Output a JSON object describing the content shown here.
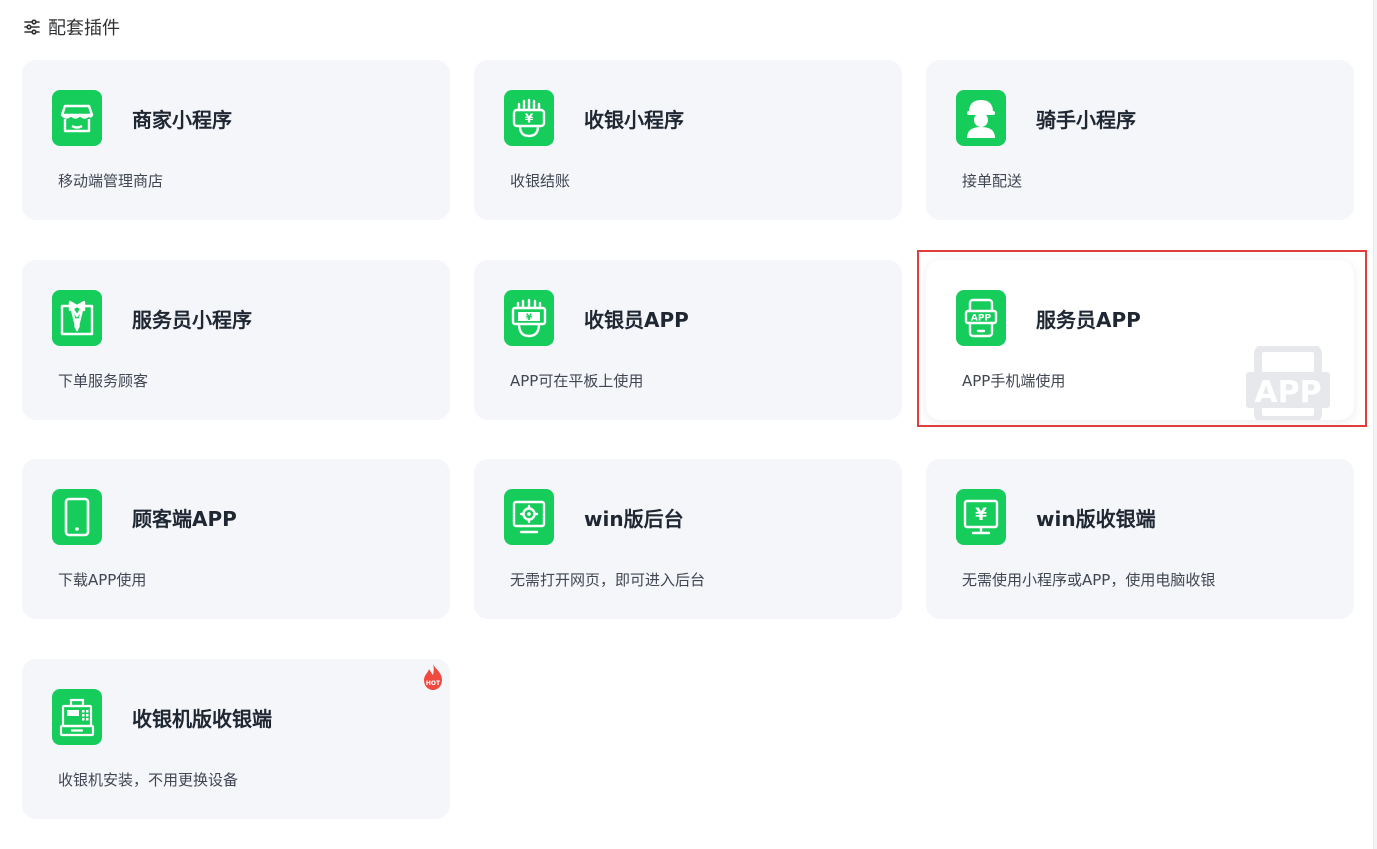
{
  "header": {
    "icon": "sliders-icon",
    "title": "配套插件"
  },
  "colors": {
    "accent": "#16cc5b",
    "highlight": "#e03d3d",
    "hot": "#f0493e"
  },
  "plugins": [
    {
      "icon": "store-icon",
      "title": "商家小程序",
      "desc": "移动端管理商店"
    },
    {
      "icon": "cashier-icon",
      "title": "收银小程序",
      "desc": "收银结账"
    },
    {
      "icon": "rider-icon",
      "title": "骑手小程序",
      "desc": "接单配送"
    },
    {
      "icon": "waiter-icon",
      "title": "服务员小程序",
      "desc": "下单服务顾客"
    },
    {
      "icon": "cashier-app-icon",
      "title": "收银员APP",
      "desc": "APP可在平板上使用"
    },
    {
      "icon": "phone-app-icon",
      "title": "服务员APP",
      "desc": "APP手机端使用",
      "watermark": "APP",
      "selected": true
    },
    {
      "icon": "tablet-icon",
      "title": "顾客端APP",
      "desc": "下载APP使用"
    },
    {
      "icon": "monitor-gear-icon",
      "title": "win版后台",
      "desc": "无需打开网页，即可进入后台"
    },
    {
      "icon": "monitor-yen-icon",
      "title": "win版收银端",
      "desc": "无需使用小程序或APP，使用电脑收银"
    },
    {
      "icon": "cash-register-icon",
      "title": "收银机版收银端",
      "desc": "收银机安装，不用更换设备",
      "badge": "HOT"
    }
  ]
}
